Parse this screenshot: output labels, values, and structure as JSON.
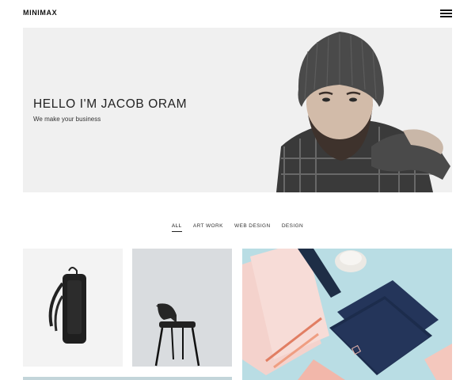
{
  "brand": {
    "logo_text": "MINIMAX"
  },
  "header": {
    "menu_icon": "hamburger-icon"
  },
  "hero": {
    "title": "HELLO I'M JACOB ORAM",
    "subtitle": "We make your business"
  },
  "filters": {
    "items": [
      "ALL",
      "ART WORK",
      "WEB DESIGN",
      "DESIGN"
    ],
    "active": "ALL"
  },
  "colors": {
    "hero_bg": "#f0f0f0",
    "tile_blue": "#b9dde4",
    "navy": "#1f2f4f",
    "pink": "#f3c9c3"
  }
}
